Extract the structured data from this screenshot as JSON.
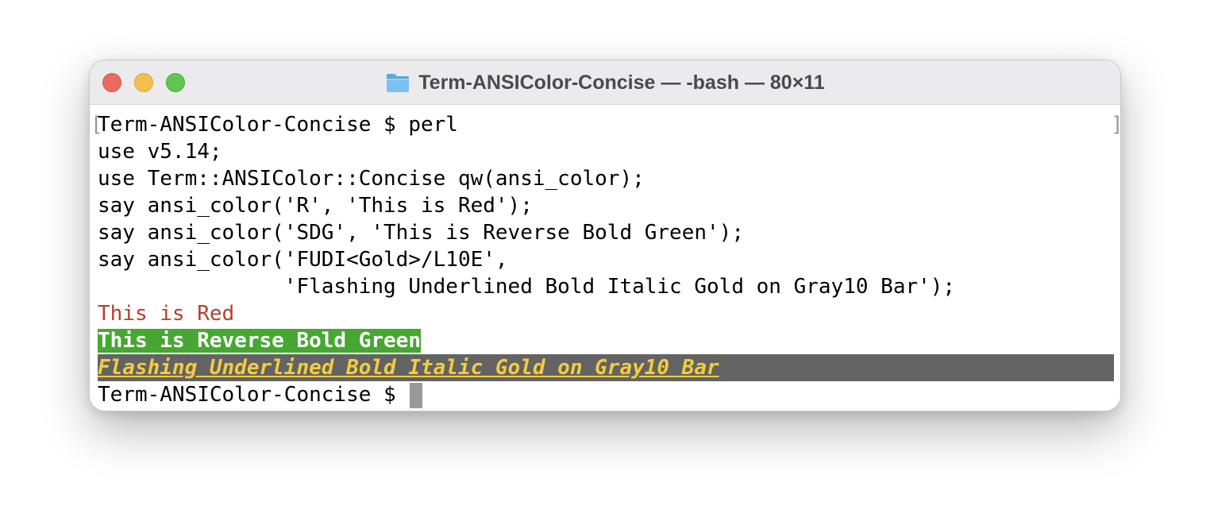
{
  "window": {
    "title": "Term-ANSIColor-Concise — -bash — 80×11",
    "folder_icon": "folder-icon"
  },
  "colors": {
    "red": "#b5402f",
    "green": "#46a832",
    "gold": "#f4cc3e",
    "gray10": "#636363"
  },
  "terminal": {
    "bracket_left": "[",
    "bracket_right": "]",
    "lines": [
      "Term-ANSIColor-Concise $ perl",
      "use v5.14;",
      "use Term::ANSIColor::Concise qw(ansi_color);",
      "say ansi_color('R', 'This is Red');",
      "say ansi_color('SDG', 'This is Reverse Bold Green');",
      "say ansi_color('FUDI<Gold>/L10E',",
      "               'Flashing Underlined Bold Italic Gold on Gray10 Bar');"
    ],
    "output_red": "This is Red",
    "output_green": "This is Reverse Bold Green",
    "output_gold": "Flashing Underlined Bold Italic Gold on Gray10 Bar",
    "prompt": "Term-ANSIColor-Concise $ "
  }
}
